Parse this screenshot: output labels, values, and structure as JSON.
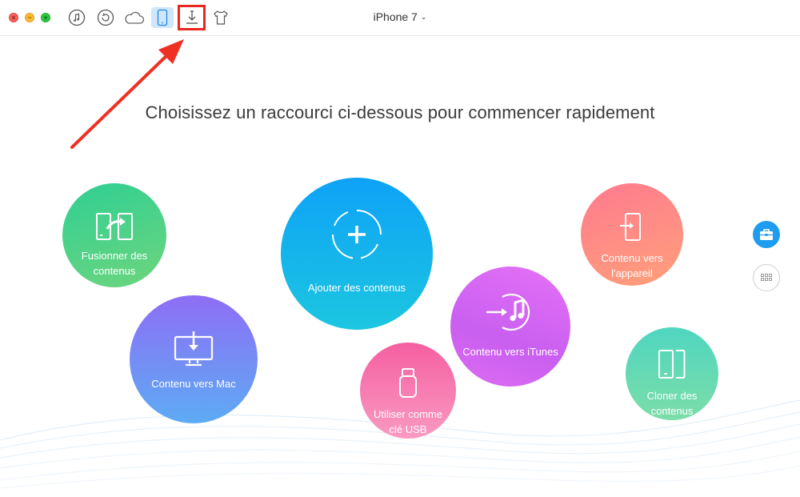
{
  "window": {
    "device_name": "iPhone 7"
  },
  "toolbar": {
    "icons": [
      "itunes-library-icon",
      "backup-restore-icon",
      "icloud-icon",
      "device-icon",
      "download-icon",
      "ringtone-shirt-icon"
    ],
    "active_icon": "device-icon",
    "highlighted_icon": "download-icon",
    "highlight_color": "#e8281e"
  },
  "main": {
    "headline": "Choisissez un raccourci ci-dessous pour commencer rapidement"
  },
  "shortcuts": {
    "fusion": {
      "label_line1": "Fusionner des",
      "label_line2": "contenus",
      "color": "#2fcf94"
    },
    "ajouter": {
      "label": "Ajouter des contenus",
      "color": "#0ea2f7"
    },
    "appareil": {
      "label_line1": "Contenu vers",
      "label_line2": "l'appareil",
      "color": "#ff7a8f"
    },
    "mac": {
      "label": "Contenu vers Mac",
      "color": "#8e6ef5"
    },
    "itunes": {
      "label": "Contenu vers iTunes",
      "color": "#d464f3"
    },
    "usb": {
      "label_line1": "Utiliser comme",
      "label_line2": "clé USB",
      "color": "#f55fa1"
    },
    "cloner": {
      "label_line1": "Cloner des",
      "label_line2": "contenus",
      "color": "#4fd6c0"
    }
  },
  "sidebar": {
    "buttons": [
      "toolkit-icon",
      "grid-icon"
    ],
    "active_color": "#1e9cf0"
  },
  "annotation": {
    "arrow_color": "#ee3124"
  }
}
